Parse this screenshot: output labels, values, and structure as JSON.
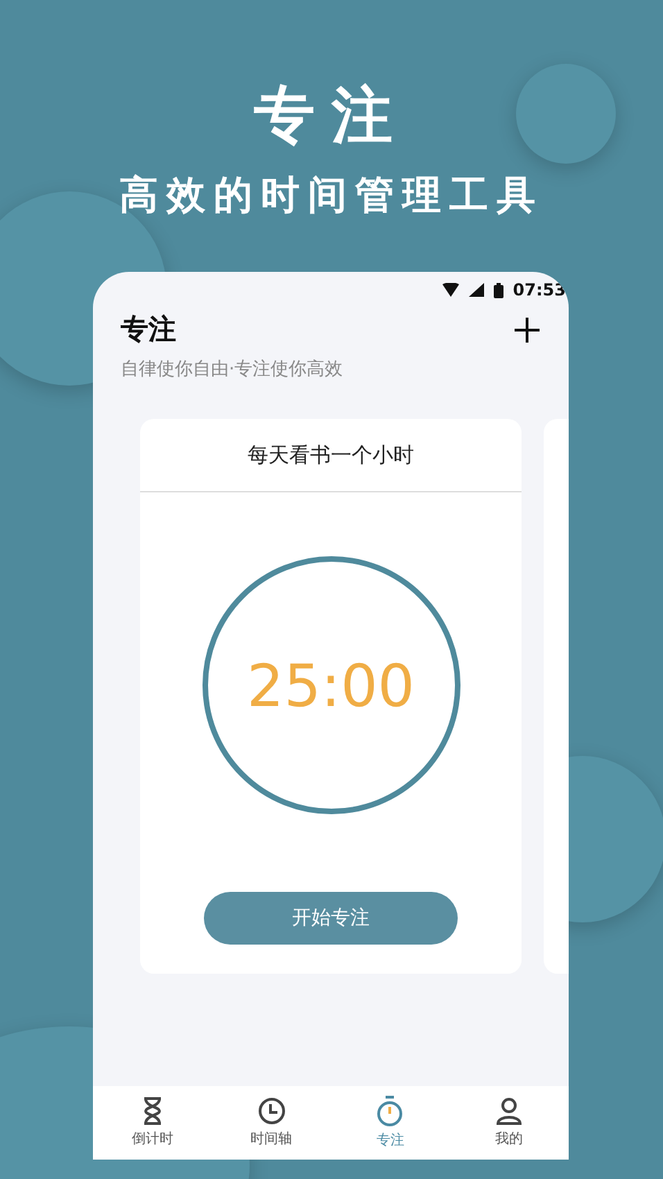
{
  "headline": "专注",
  "tagline": "高效的时间管理工具",
  "status_bar": {
    "time": "07:53"
  },
  "header": {
    "title": "专注",
    "subtitle": "自律使你自由·专注使你高效"
  },
  "cards": [
    {
      "title": "每天看书一个小时",
      "timer": "25:00",
      "button": "开始专注"
    }
  ],
  "tabs": [
    {
      "label": "倒计时",
      "selected": false
    },
    {
      "label": "时间轴",
      "selected": false
    },
    {
      "label": "专注",
      "selected": true
    },
    {
      "label": "我的",
      "selected": false
    }
  ]
}
